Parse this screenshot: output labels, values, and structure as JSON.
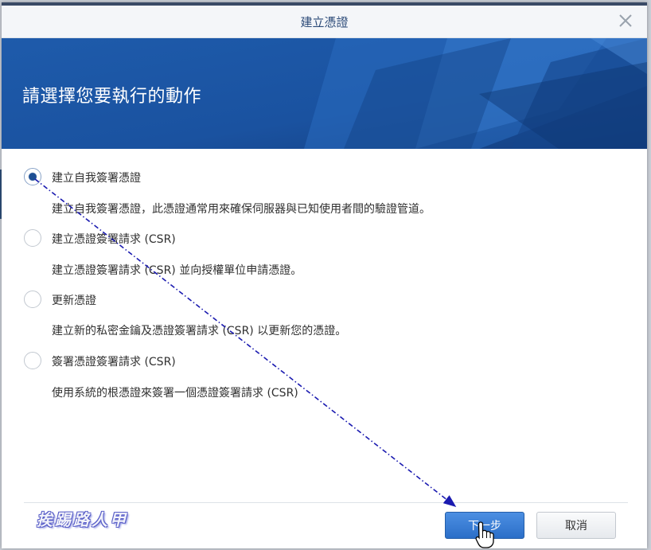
{
  "dialog": {
    "title": "建立憑證",
    "heading": "請選擇您要執行的動作"
  },
  "options": [
    {
      "label": "建立自我簽署憑證",
      "description": "建立自我簽署憑證，此憑證通常用來確保伺服器與已知使用者間的驗證管道。",
      "checked": true
    },
    {
      "label": "建立憑證簽署請求 (CSR)",
      "description": "建立憑證簽署請求 (CSR) 並向授權單位申請憑證。",
      "checked": false
    },
    {
      "label": "更新憑證",
      "description": "建立新的私密金鑰及憑證簽署請求 (CSR) 以更新您的憑證。",
      "checked": false
    },
    {
      "label": "簽署憑證簽署請求 (CSR)",
      "description": "使用系統的根憑證來簽署一個憑證簽署請求 (CSR)",
      "checked": false
    }
  ],
  "buttons": {
    "next_label": "下一步",
    "cancel_label": "取消"
  },
  "watermark": "挨踢路人甲",
  "colors": {
    "accent": "#2b6fc8",
    "banner": "#1f5aa6",
    "title": "#2b4a78"
  }
}
